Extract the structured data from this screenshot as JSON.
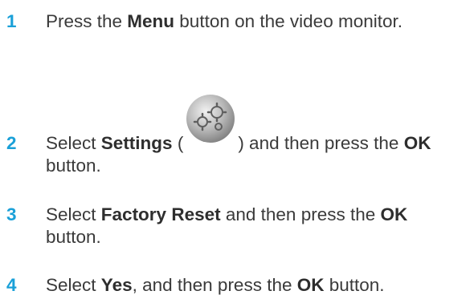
{
  "steps": [
    {
      "number": "1",
      "parts": [
        "Press the ",
        "Menu",
        " button on the video monitor."
      ]
    },
    {
      "number": "2",
      "parts": [
        "Select ",
        "Settings",
        " (",
        ") and then press the ",
        "OK",
        " button."
      ],
      "icon": "settings-gears-icon"
    },
    {
      "number": "3",
      "parts": [
        "Select ",
        "Factory Reset",
        " and then press the ",
        "OK",
        " button."
      ]
    },
    {
      "number": "4",
      "parts": [
        "Select ",
        "Yes",
        ", and then press the ",
        "OK",
        " button."
      ]
    }
  ],
  "colors": {
    "step_number": "#1aa0d8",
    "text": "#3a3a3a"
  }
}
